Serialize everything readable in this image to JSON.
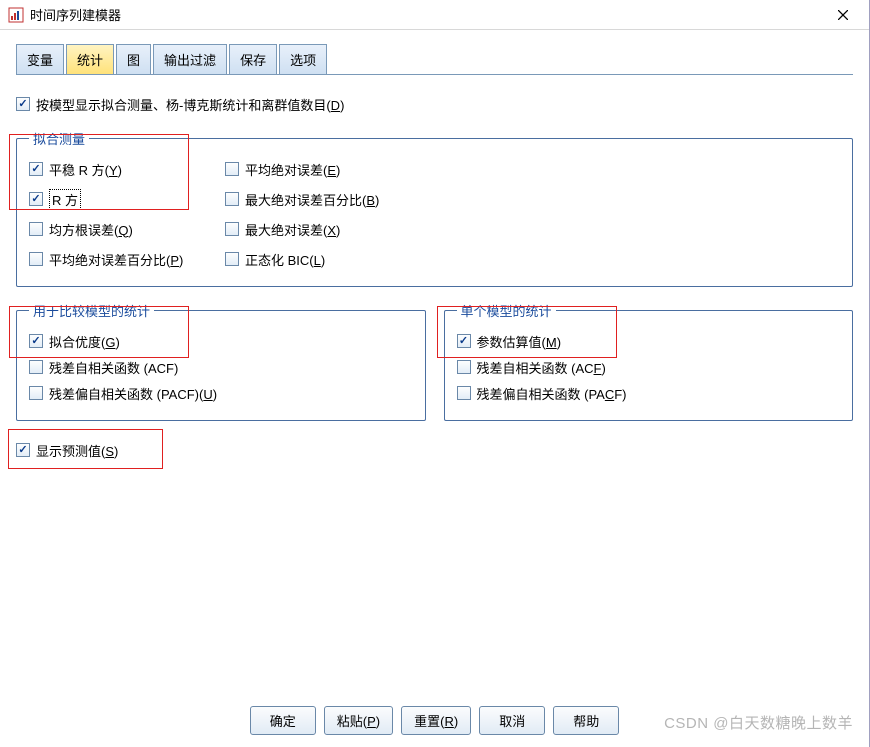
{
  "window": {
    "title": "时间序列建模器"
  },
  "tabs": {
    "t0": "变量",
    "t1": "统计",
    "t2": "图",
    "t3": "输出过滤",
    "t4": "保存",
    "t5": "选项"
  },
  "top_check": {
    "pre": "按模型显示拟合测量、杨-博克斯统计和离群值数目(",
    "mn": "D",
    "post": ")"
  },
  "fit": {
    "legend": "拟合测量",
    "r1c1_pre": "平稳 R 方(",
    "r1c1_mn": "Y",
    "r1c1_post": ")",
    "r1c2_pre": "平均绝对误差(",
    "r1c2_mn": "E",
    "r1c2_post": ")",
    "r2c1": "R 方",
    "r2c2_pre": "最大绝对误差百分比(",
    "r2c2_mn": "B",
    "r2c2_post": ")",
    "r3c1_pre": "均方根误差(",
    "r3c1_mn": "Q",
    "r3c1_post": ")",
    "r3c2_pre": "最大绝对误差(",
    "r3c2_mn": "X",
    "r3c2_post": ")",
    "r4c1_pre": "平均绝对误差百分比(",
    "r4c1_mn": "P",
    "r4c1_post": ")",
    "r4c2_pre": "正态化 BIC(",
    "r4c2_mn": "L",
    "r4c2_post": ")"
  },
  "compare": {
    "legend": "用于比较模型的统计",
    "i1_pre": "拟合优度(",
    "i1_mn": "G",
    "i1_post": ")",
    "i2": "残差自相关函数 (ACF)",
    "i3_pre": "残差偏自相关函数 (PACF)(",
    "i3_mn": "U",
    "i3_post": ")"
  },
  "single": {
    "legend": "单个模型的统计",
    "i1_pre": "参数估算值(",
    "i1_mn": "M",
    "i1_post": ")",
    "i2_pre": "残差自相关函数 (AC",
    "i2_mn": "F",
    "i2_post": ")",
    "i3_pre": "残差偏自相关函数 (PA",
    "i3_mn": "C",
    "i3_post": "F)"
  },
  "forecast": {
    "pre": "显示预测值(",
    "mn": "S",
    "post": ")"
  },
  "buttons": {
    "ok": "确定",
    "paste_pre": "粘贴(",
    "paste_mn": "P",
    "paste_post": ")",
    "reset_pre": "重置(",
    "reset_mn": "R",
    "reset_post": ")",
    "cancel": "取消",
    "help": "帮助"
  },
  "watermark": "CSDN @白天数糖晚上数羊"
}
